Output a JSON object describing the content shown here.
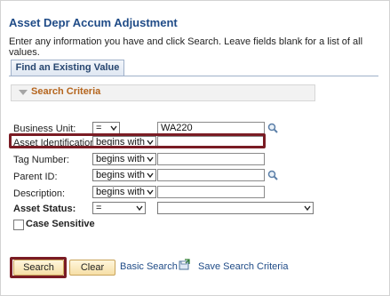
{
  "page": {
    "title": "Asset Depr Accum Adjustment",
    "instructions": "Enter any information you have and click Search. Leave fields blank for a list of all values."
  },
  "tab": {
    "find_existing_label": "Find an Existing Value"
  },
  "search_criteria": {
    "header": "Search Criteria",
    "fields": {
      "business_unit": {
        "label": "Business Unit:",
        "operator": "=",
        "value": "WA220"
      },
      "asset_identification": {
        "label": "Asset Identification:",
        "operator": "begins with",
        "value": ""
      },
      "tag_number": {
        "label": "Tag Number:",
        "operator": "begins with",
        "value": ""
      },
      "parent_id": {
        "label": "Parent ID:",
        "operator": "begins with",
        "value": ""
      },
      "description": {
        "label": "Description:",
        "operator": "begins with",
        "value": ""
      },
      "asset_status": {
        "label": "Asset Status:",
        "operator": "=",
        "value": ""
      }
    },
    "case_sensitive_label": "Case Sensitive"
  },
  "actions": {
    "search_label": "Search",
    "clear_label": "Clear",
    "basic_search_label": "Basic Search",
    "save_search_label": "Save Search Criteria"
  },
  "colors": {
    "title": "#1f4b87",
    "criteria_header": "#b5651d",
    "highlight": "#7a1c24",
    "button_fill": "#f6dfa6"
  },
  "icons": {
    "lookup": "magnifier-icon",
    "dropdown": "chevron-down-icon",
    "collapse": "triangle-down-icon",
    "save": "save-search-icon"
  }
}
